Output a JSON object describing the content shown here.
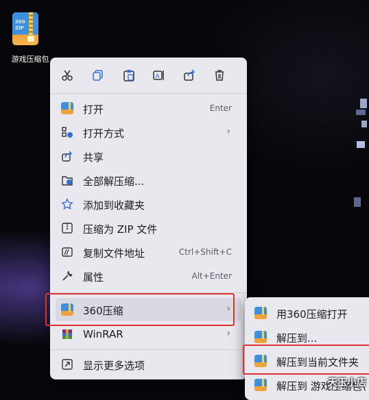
{
  "desktop": {
    "icon_label": "游戏压缩包"
  },
  "toolbar": {
    "icons": [
      "cut-icon",
      "copy-icon",
      "paste-icon",
      "rename-icon",
      "share-icon",
      "delete-icon"
    ]
  },
  "menu": {
    "items": [
      {
        "label": "打开",
        "shortcut": "Enter"
      },
      {
        "label": "打开方式"
      },
      {
        "label": "共享"
      },
      {
        "label": "全部解压缩..."
      },
      {
        "label": "添加到收藏夹"
      },
      {
        "label": "压缩为 ZIP 文件"
      },
      {
        "label": "复制文件地址",
        "shortcut": "Ctrl+Shift+C"
      },
      {
        "label": "属性",
        "shortcut": "Alt+Enter"
      },
      {
        "label": "360压缩"
      },
      {
        "label": "WinRAR"
      },
      {
        "label": "显示更多选项"
      }
    ]
  },
  "submenu": {
    "items": [
      {
        "label": "用360压缩打开"
      },
      {
        "label": "解压到..."
      },
      {
        "label": "解压到当前文件夹"
      },
      {
        "label": "解压到 游戏压缩包\\"
      }
    ]
  },
  "watermark": "天玉小店",
  "colors": {
    "highlight": "#e03131",
    "menu_bg": "#e8e8ee"
  }
}
